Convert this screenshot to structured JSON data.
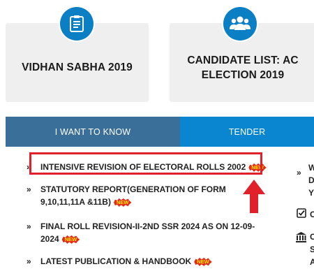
{
  "cards": [
    {
      "title": "VIDHAN SABHA 2019",
      "icon": "checklist-icon"
    },
    {
      "title": "CANDIDATE LIST: AC ELECTION 2019",
      "icon": "people-group-icon"
    }
  ],
  "tabs": [
    {
      "label": "I WANT TO KNOW",
      "active": true
    },
    {
      "label": "TENDER",
      "active": false
    }
  ],
  "list": {
    "bullet": "»",
    "badge": "NEW",
    "items": [
      {
        "text": "INTENSIVE REVISION OF ELECTORAL ROLLS 2002"
      },
      {
        "text": "STATUTORY REPORT(GENERATION OF FORM 9,10,11,11A &11B)"
      },
      {
        "text": "FINAL ROLL REVISION-II-2ND SSR 2024 AS ON 12-09-2024"
      },
      {
        "text": "LATEST PUBLICATION & HANDBOOK"
      }
    ]
  },
  "right_column": {
    "item1_lines": [
      "WI",
      "DR",
      "YO"
    ],
    "item2_text": "CI",
    "item3_lines": [
      "C",
      "S",
      "A"
    ]
  },
  "colors": {
    "accent": "#0b7fc3",
    "tab_active": "#3a6f9a",
    "tab_inactive": "#0a86d0",
    "highlight": "#e0202a",
    "badge": "#e52b12"
  }
}
